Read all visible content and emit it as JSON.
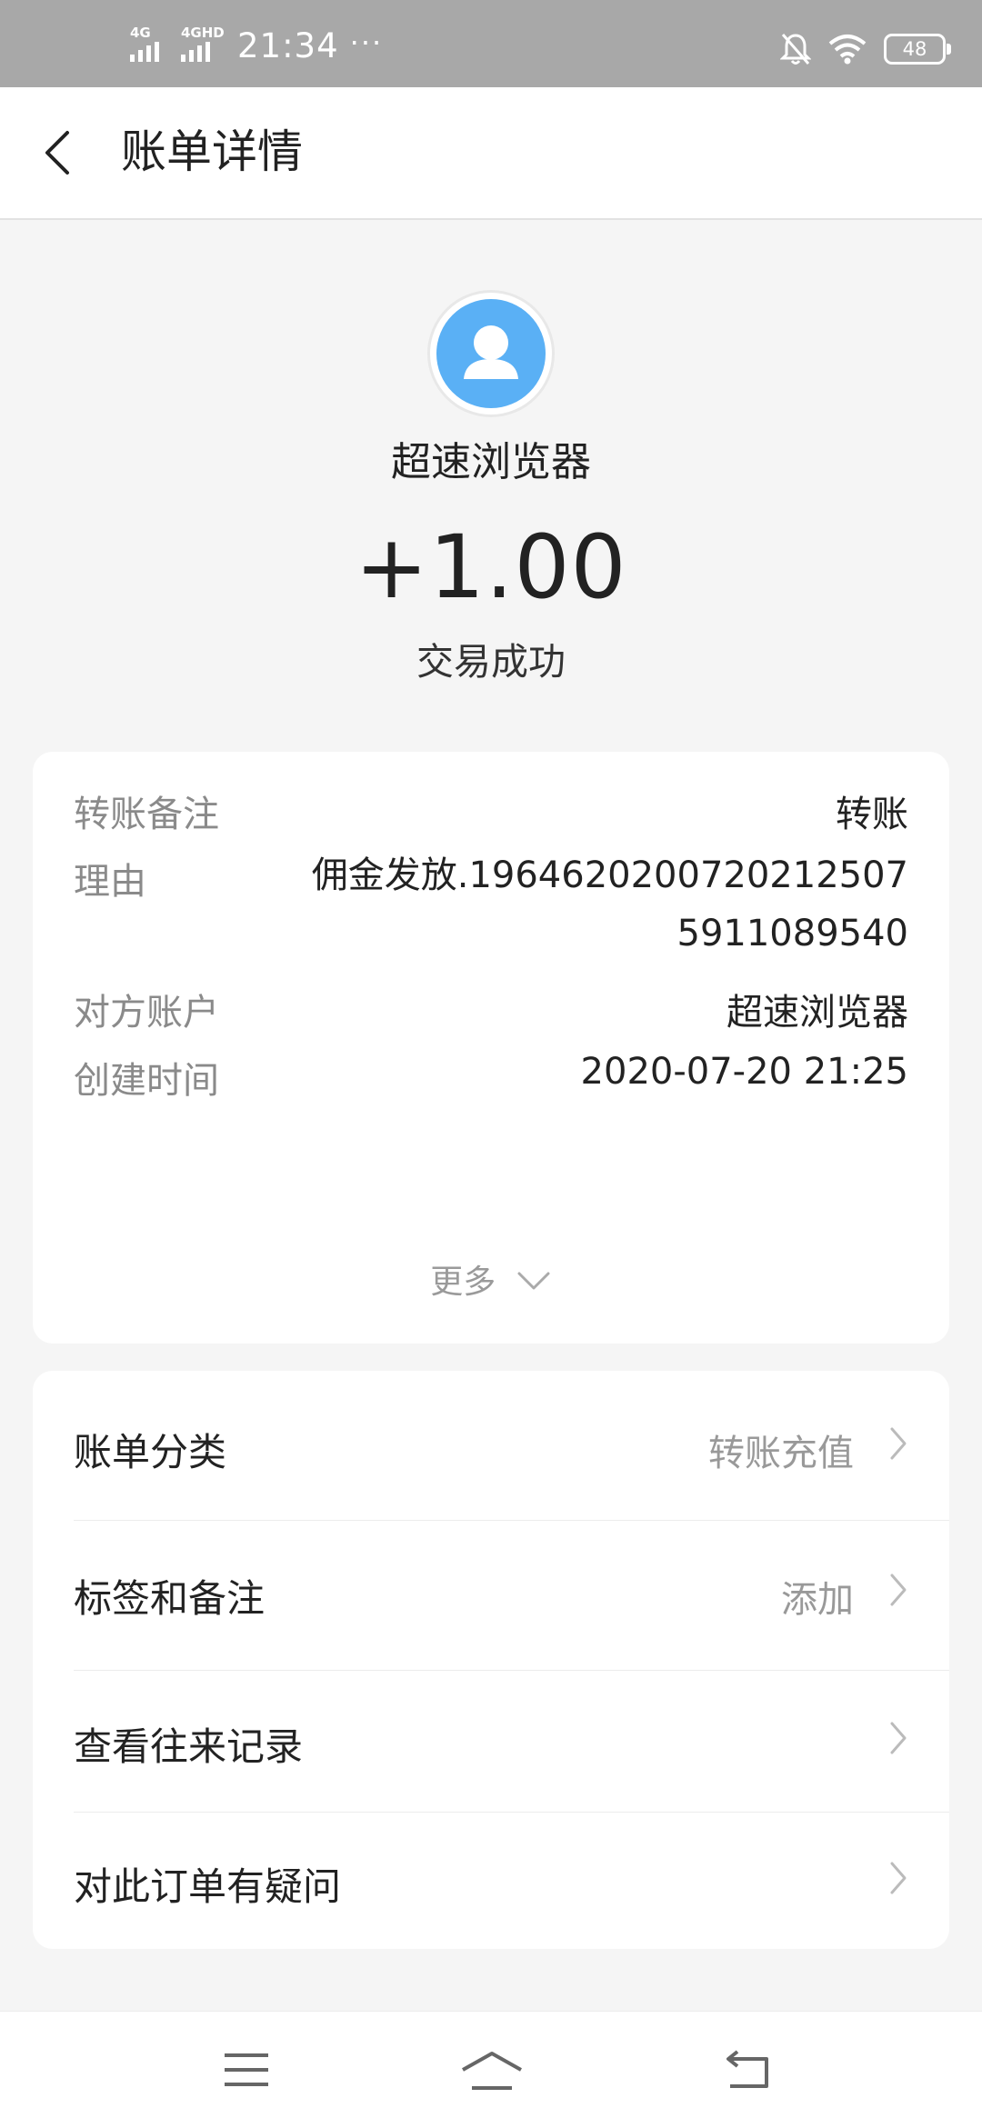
{
  "status_bar": {
    "net1": "4G",
    "net2": "4GHD",
    "time": "21:34",
    "more_dots": "···",
    "battery": "48",
    "icons": [
      "bell-off-icon",
      "wifi-icon",
      "battery-icon"
    ]
  },
  "header": {
    "title": "账单详情",
    "back_icon": "chevron-left-icon"
  },
  "summary": {
    "merchant": "超速浏览器",
    "amount": "+1.00",
    "status": "交易成功",
    "avatar_color": "#5ab0f5"
  },
  "details": {
    "rows": [
      {
        "label": "转账备注",
        "value": "转账"
      },
      {
        "label": "理由",
        "value": "佣金发放.1964620200720212507\n5911089540"
      },
      {
        "label": "对方账户",
        "value": "超速浏览器"
      },
      {
        "label": "创建时间",
        "value": "2020-07-20 21:25"
      }
    ],
    "more_label": "更多"
  },
  "menu": {
    "items": [
      {
        "label": "账单分类",
        "value": "转账充值"
      },
      {
        "label": "标签和备注",
        "value": "添加"
      },
      {
        "label": "查看往来记录",
        "value": ""
      },
      {
        "label": "对此订单有疑问",
        "value": ""
      }
    ]
  },
  "nav": {
    "icons": [
      "menu-icon",
      "home-icon",
      "back-icon"
    ]
  }
}
